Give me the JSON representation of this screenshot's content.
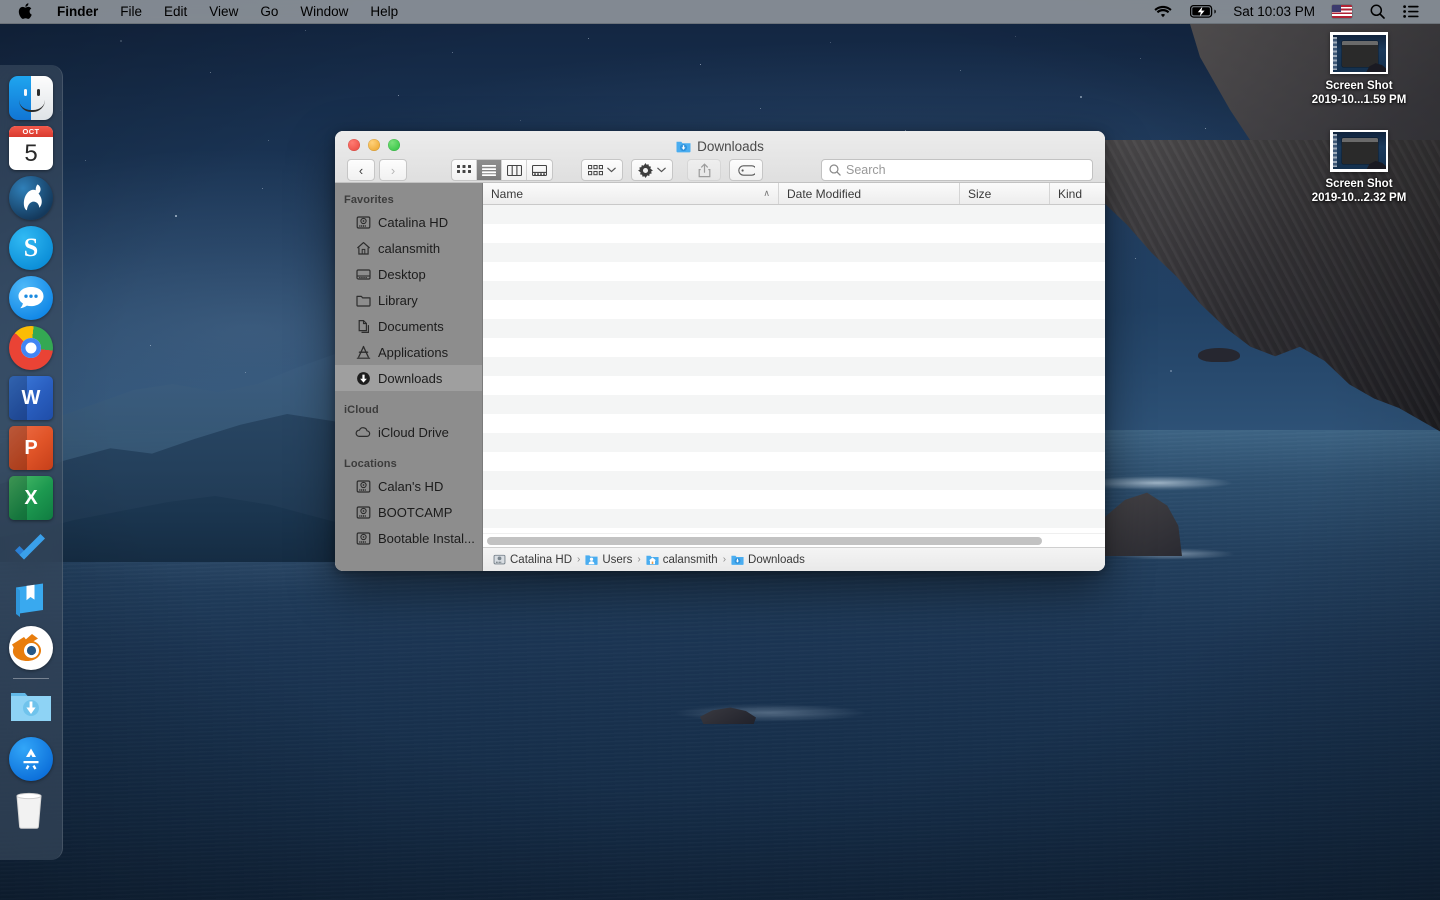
{
  "menubar": {
    "apple_icon": "apple-logo-icon",
    "items": [
      {
        "label": "Finder",
        "bold": true
      },
      {
        "label": "File",
        "bold": false
      },
      {
        "label": "Edit",
        "bold": false
      },
      {
        "label": "View",
        "bold": false
      },
      {
        "label": "Go",
        "bold": false
      },
      {
        "label": "Window",
        "bold": false
      },
      {
        "label": "Help",
        "bold": false
      }
    ],
    "status": {
      "wifi_icon": "wifi-icon",
      "battery_icon": "battery-charging-icon",
      "clock": "Sat 10:03 PM",
      "input_source_icon": "us-flag-icon",
      "search_icon": "spotlight-search-icon",
      "control_center_icon": "control-center-icon"
    }
  },
  "dock": {
    "items": [
      {
        "name": "finder",
        "label": "Finder",
        "running": true
      },
      {
        "name": "calendar",
        "label": "Calendar",
        "month": "OCT",
        "day": "5",
        "running": true
      },
      {
        "name": "llama-app",
        "label": "Llama",
        "running": false
      },
      {
        "name": "skype",
        "label": "Skype",
        "glyph": "S",
        "running": false
      },
      {
        "name": "messages",
        "label": "Messages",
        "running": true
      },
      {
        "name": "google-chrome",
        "label": "Google Chrome",
        "running": true
      },
      {
        "name": "microsoft-word",
        "label": "Microsoft Word",
        "glyph": "W",
        "running": false
      },
      {
        "name": "microsoft-powerpoint",
        "label": "Microsoft PowerPoint",
        "glyph": "P",
        "running": false
      },
      {
        "name": "microsoft-excel",
        "label": "Microsoft Excel",
        "glyph": "X",
        "running": false
      },
      {
        "name": "microsoft-todo",
        "label": "Microsoft To Do",
        "running": false
      },
      {
        "name": "bookmark-app",
        "label": "Books",
        "running": false
      },
      {
        "name": "blender",
        "label": "Blender",
        "running": false
      }
    ],
    "stack_items": [
      {
        "name": "downloads-stack",
        "label": "Downloads"
      },
      {
        "name": "app-store",
        "label": "App Store"
      },
      {
        "name": "trash",
        "label": "Trash"
      }
    ]
  },
  "desktop_icons": [
    {
      "label": "Screen Shot\n2019-10...1.59 PM",
      "type": "screenshot-file"
    },
    {
      "label": "Screen Shot\n2019-10...2.32 PM",
      "type": "screenshot-file"
    }
  ],
  "finder": {
    "title": "Downloads",
    "title_icon": "downloads-folder-icon",
    "window_controls": {
      "close": "close-button",
      "minimize": "minimize-button",
      "zoom": "zoom-button"
    },
    "toolbar": {
      "back_label": "‹",
      "forward_label": "›",
      "view_buttons": [
        {
          "name": "icon-view",
          "active": false
        },
        {
          "name": "list-view",
          "active": true
        },
        {
          "name": "column-view",
          "active": false
        },
        {
          "name": "gallery-view",
          "active": false
        }
      ],
      "group_button": "group-by-button",
      "action_button": "action-gear-button",
      "share_button": "share-button",
      "tag_button": "tag-button",
      "caret": "⌄"
    },
    "search": {
      "placeholder": "Search",
      "value": "",
      "icon": "search-icon"
    },
    "sidebar": {
      "sections": [
        {
          "title": "Favorites",
          "items": [
            {
              "label": "Catalina HD",
              "icon": "hard-drive-icon",
              "selected": false
            },
            {
              "label": "calansmith",
              "icon": "home-icon",
              "selected": false
            },
            {
              "label": "Desktop",
              "icon": "desktop-icon",
              "selected": false
            },
            {
              "label": "Library",
              "icon": "folder-icon",
              "selected": false
            },
            {
              "label": "Documents",
              "icon": "documents-icon",
              "selected": false
            },
            {
              "label": "Applications",
              "icon": "applications-icon",
              "selected": false
            },
            {
              "label": "Downloads",
              "icon": "downloads-icon",
              "selected": true
            }
          ]
        },
        {
          "title": "iCloud",
          "items": [
            {
              "label": "iCloud Drive",
              "icon": "cloud-icon",
              "selected": false
            }
          ]
        },
        {
          "title": "Locations",
          "items": [
            {
              "label": "Calan's HD",
              "icon": "hard-drive-icon",
              "selected": false
            },
            {
              "label": "BOOTCAMP",
              "icon": "hard-drive-icon",
              "selected": false
            },
            {
              "label": "Bootable Instal...",
              "icon": "hard-drive-icon",
              "selected": false
            }
          ]
        }
      ]
    },
    "columns": [
      {
        "label": "Name",
        "sorted": true,
        "sort_arrow": "∧"
      },
      {
        "label": "Date Modified",
        "sorted": false
      },
      {
        "label": "Size",
        "sorted": false
      },
      {
        "label": "Kind",
        "sorted": false
      }
    ],
    "files": [],
    "file_row_count": 17,
    "pathbar": [
      {
        "label": "Catalina HD",
        "icon": "hard-drive-icon"
      },
      {
        "label": "Users",
        "icon": "users-folder-icon"
      },
      {
        "label": "calansmith",
        "icon": "home-folder-icon"
      },
      {
        "label": "Downloads",
        "icon": "downloads-folder-icon"
      }
    ],
    "pathbar_separator": "›"
  },
  "colors": {
    "accent": "#1175d4",
    "sidebar_bg": "#8d8d8d",
    "menubar_bg": "#9ba0a5",
    "traffic_red": "#e8453c",
    "traffic_yellow": "#e9a023",
    "traffic_green": "#28c03c",
    "folder_blue": "#52b7f5",
    "wallpaper_sky": "#1d3a5c",
    "wallpaper_sea": "#1b3553"
  }
}
